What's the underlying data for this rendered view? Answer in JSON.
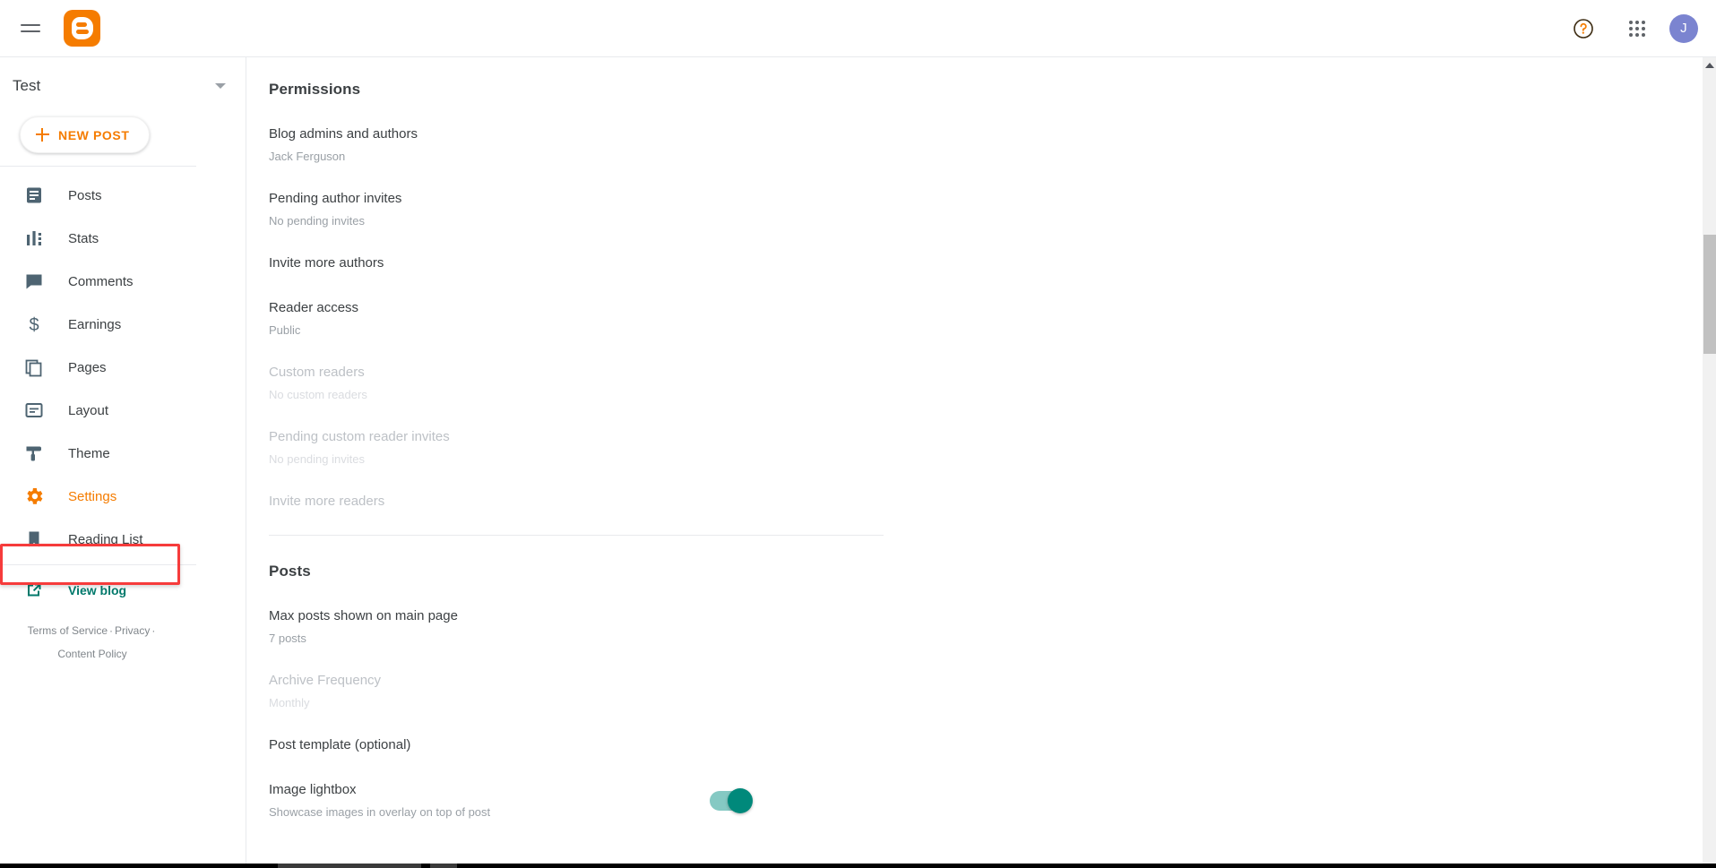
{
  "appbar": {
    "menu_icon": "hamburger-menu-icon",
    "logo_icon": "blogger-logo-icon",
    "help_icon": "help-circle-icon",
    "apps_icon": "google-apps-grid-icon",
    "avatar_initial": "J"
  },
  "sidebar": {
    "blog_name": "Test",
    "new_post_label": "NEW POST",
    "items": [
      {
        "label": "Posts",
        "icon": "posts-icon",
        "active": false
      },
      {
        "label": "Stats",
        "icon": "stats-icon",
        "active": false
      },
      {
        "label": "Comments",
        "icon": "comments-icon",
        "active": false
      },
      {
        "label": "Earnings",
        "icon": "earnings-icon",
        "active": false
      },
      {
        "label": "Pages",
        "icon": "pages-icon",
        "active": false
      },
      {
        "label": "Layout",
        "icon": "layout-icon",
        "active": false
      },
      {
        "label": "Theme",
        "icon": "theme-icon",
        "active": false
      },
      {
        "label": "Settings",
        "icon": "settings-gear-icon",
        "active": true
      },
      {
        "label": "Reading List",
        "icon": "reading-list-icon",
        "active": false
      }
    ],
    "view_blog_label": "View blog",
    "view_blog_icon": "external-link-icon",
    "footer": {
      "terms": "Terms of Service",
      "privacy": "Privacy",
      "content_policy": "Content Policy",
      "separator": "·"
    }
  },
  "highlight": {
    "target": "Settings",
    "color": "#f63b3b"
  },
  "main": {
    "sections": [
      {
        "title": "Permissions",
        "rows": [
          {
            "label": "Blog admins and authors",
            "value": "Jack Ferguson",
            "disabled": false
          },
          {
            "label": "Pending author invites",
            "value": "No pending invites",
            "disabled": false
          },
          {
            "label": "Invite more authors",
            "value": "",
            "disabled": false
          },
          {
            "label": "Reader access",
            "value": "Public",
            "disabled": false
          },
          {
            "label": "Custom readers",
            "value": "No custom readers",
            "disabled": true
          },
          {
            "label": "Pending custom reader invites",
            "value": "No pending invites",
            "disabled": true
          },
          {
            "label": "Invite more readers",
            "value": "",
            "disabled": true
          }
        ]
      },
      {
        "title": "Posts",
        "rows": [
          {
            "label": "Max posts shown on main page",
            "value": "7 posts",
            "disabled": false
          },
          {
            "label": "Archive Frequency",
            "value": "Monthly",
            "disabled": true
          },
          {
            "label": "Post template (optional)",
            "value": "",
            "disabled": false
          },
          {
            "label": "Image lightbox",
            "value": "Showcase images in overlay on top of post",
            "disabled": false,
            "toggle": true,
            "toggle_on": true
          }
        ]
      }
    ]
  },
  "colors": {
    "brand_orange": "#f57c00",
    "teal": "#00796b",
    "toggle_on": "#00897b",
    "toggle_track": "#85c9c3",
    "highlight_red": "#f63b3b",
    "avatar_purple": "#7b84d0"
  },
  "scrollbar": {
    "thumb_top_pct": 22,
    "thumb_height_pct": 15
  }
}
